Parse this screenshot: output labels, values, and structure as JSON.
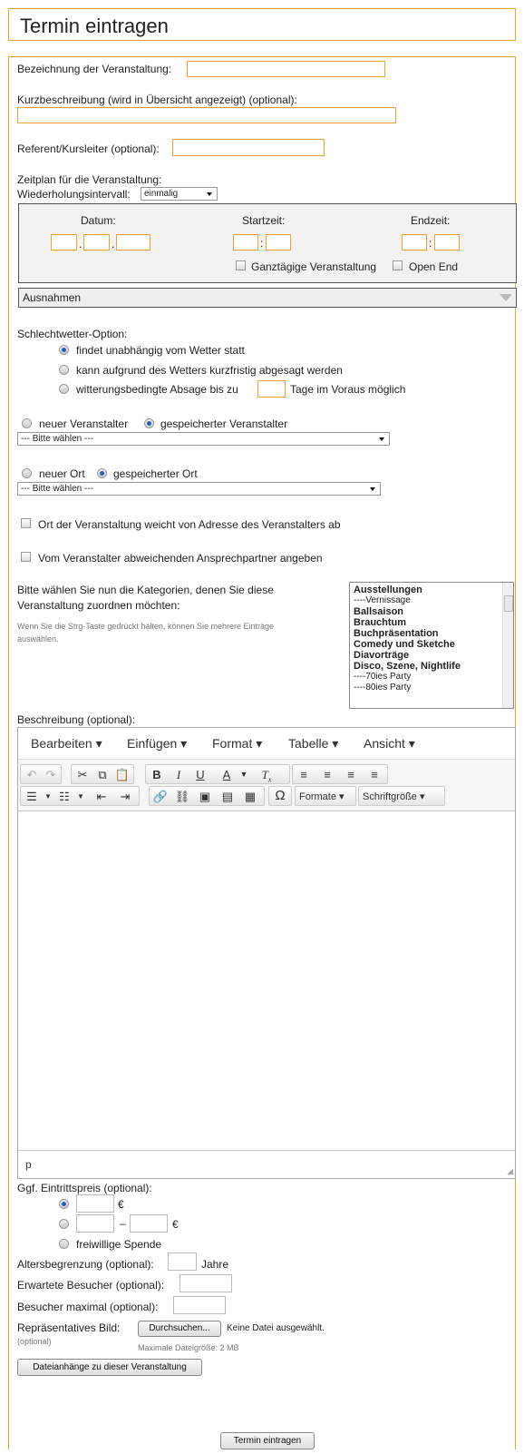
{
  "header": {
    "title": "Termin eintragen"
  },
  "fields": {
    "bezeichnung_label": "Bezeichnung der Veranstaltung:",
    "kurz_label": "Kurzbeschreibung (wird in Übersicht angezeigt) (optional):",
    "referent_label": "Referent/Kursleiter (optional):",
    "zeitplan_label": "Zeitplan für die Veranstaltung:",
    "wiederholung_label": "Wiederholungsintervall:",
    "wiederholung_value": "einmalig"
  },
  "schedule": {
    "datum": "Datum:",
    "startzeit": "Startzeit:",
    "endzeit": "Endzeit:",
    "ganztaegig": "Ganztägige Veranstaltung",
    "open_end": "Open End",
    "ausnahmen": "Ausnahmen"
  },
  "weather": {
    "label": "Schlechtwetter-Option:",
    "opt1": "findet unabhängig vom Wetter statt",
    "opt2": "kann aufgrund des Wetters kurzfristig abgesagt werden",
    "opt3_pre": "witterungsbedingte Absage bis zu",
    "opt3_post": "Tage im Voraus möglich"
  },
  "veranstalter": {
    "neu": "neuer Veranstalter",
    "gespeichert": "gespeicherter Veranstalter",
    "select": "--- Bitte wählen ---"
  },
  "ort": {
    "neu": "neuer Ort",
    "gespeichert": "gespeicherter Ort",
    "select": "--- Bitte wählen ---"
  },
  "checks": {
    "ort_abweichend": "Ort der Veranstaltung weicht von Adresse des Veranstalters ab",
    "ansprechpartner": "Vom Veranstalter abweichenden Ansprechpartner angeben"
  },
  "kategorien": {
    "text1": "Bitte wählen Sie nun die Kategorien, denen Sie diese",
    "text2": "Veranstaltung zuordnen möchten:",
    "hint1": "Wenn Sie die Strg-Taste gedrückt halten, können Sie mehrere Einträge",
    "hint2": "auswählen.",
    "items": [
      "Ausstellungen",
      "----Vernissage",
      "Ballsaison",
      "Brauchtum",
      "Buchpräsentation",
      "Comedy und Sketche",
      "Diavorträge",
      "Disco, Szene, Nightlife",
      "----70ies Party",
      "----80ies Party"
    ]
  },
  "editor": {
    "label": "Beschreibung (optional):",
    "menus": [
      "Bearbeiten ▾",
      "Einfügen ▾",
      "Format ▾",
      "Tabelle ▾",
      "Ansicht ▾"
    ],
    "formate": "Formate ▾",
    "schriftgroesse": "Schriftgröße ▾",
    "status": "p"
  },
  "preis": {
    "label": "Ggf. Eintrittspreis (optional):",
    "euro": "€",
    "dash": "–",
    "spende": "freiwillige Spende"
  },
  "extra": {
    "alter_label": "Altersbegrenzung (optional):",
    "jahre": "Jahre",
    "erwartet_label": "Erwartete Besucher (optional):",
    "maximal_label": "Besucher maximal (optional):",
    "bild_label": "Repräsentatives Bild:",
    "optional": "(optional)",
    "durchsuchen": "Durchsuchen...",
    "keine_datei": "Keine Datei ausgewählt.",
    "max_groesse": "Maximale Dateigröße: 2 MB",
    "anhaenge": "Dateianhänge zu dieser Veranstaltung",
    "submit": "Termin eintragen"
  }
}
